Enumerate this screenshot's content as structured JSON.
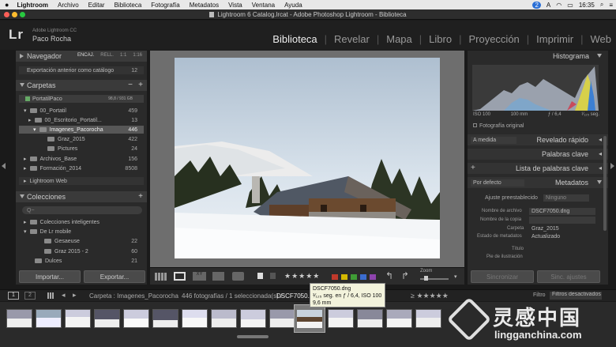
{
  "menubar": {
    "items": [
      "Lightroom",
      "Archivo",
      "Editar",
      "Biblioteca",
      "Fotografía",
      "Metadatos",
      "Vista",
      "Ventana",
      "Ayuda"
    ],
    "status": {
      "badge": "2",
      "flag": "A",
      "time": "16:35"
    }
  },
  "window": {
    "title": "Lightroom 6 Catalog.lrcat - Adobe Photoshop Lightroom - Biblioteca"
  },
  "brand": {
    "logo": "Lr",
    "product": "Adobe Lightroom CC",
    "user": "Paco Rocha"
  },
  "modules": [
    "Biblioteca",
    "Revelar",
    "Mapa",
    "Libro",
    "Proyección",
    "Imprimir",
    "Web"
  ],
  "left": {
    "navigator": {
      "title": "Navegador",
      "zoom": [
        "ENCAJ.",
        "RELL.",
        "1:1",
        "1:16"
      ]
    },
    "export_row": {
      "label": "Exportación anterior como catálogo",
      "count": "12"
    },
    "folders": {
      "title": "Carpetas",
      "volume": {
        "label": "PortatilPaco",
        "size": "98,8 / 931 GB"
      },
      "items": [
        {
          "label": "00_Portatil",
          "count": "459"
        },
        {
          "label": "00_Escritorio_Portatil...",
          "count": "13"
        },
        {
          "label": "Imagenes_Pacorocha",
          "count": "446"
        },
        {
          "label": "Graz_2015",
          "count": "422"
        },
        {
          "label": "Pictures",
          "count": "24"
        },
        {
          "label": "Archivos_Base",
          "count": "156"
        },
        {
          "label": "Formación_2014",
          "count": "8508"
        }
      ]
    },
    "web": {
      "label": "Lightroom Web"
    },
    "collections": {
      "title": "Colecciones",
      "search_placeholder": "Q~",
      "items": [
        {
          "label": "Colecciones inteligentes",
          "count": ""
        },
        {
          "label": "De Lr mobile",
          "count": ""
        },
        {
          "label": "Gesaeuse",
          "count": "22"
        },
        {
          "label": "Graz 2015 - 2",
          "count": "60"
        },
        {
          "label": "Dulces",
          "count": "21"
        }
      ]
    },
    "buttons": {
      "import": "Importar...",
      "export": "Exportar..."
    }
  },
  "right": {
    "histogram": {
      "title": "Histograma",
      "iso": "ISO 100",
      "focal": "100 mm",
      "aperture": "ƒ / 6,4",
      "shutter": "¹⁄₁₂₅ seg.",
      "original": "Fotografía original"
    },
    "quick_develop": {
      "title": "Revelado rápido",
      "preset": "A medida"
    },
    "keywords": {
      "title": "Palabras clave"
    },
    "keyword_list": {
      "title": "Lista de palabras clave"
    },
    "metadata": {
      "title": "Metadatos",
      "preset_select": "Por defecto",
      "preset_label": "Ajuste preestablecido",
      "preset_value": "Ninguno",
      "fields": [
        {
          "label": "Nombre de archivo",
          "value": "DSCF7050.dng"
        },
        {
          "label": "Nombre de la copia",
          "value": ""
        },
        {
          "label": "Carpeta",
          "value": "Graz_2015"
        },
        {
          "label": "Estado de metadatos",
          "value": "Actualizado"
        },
        {
          "label": "Título",
          "value": ""
        },
        {
          "label": "Pie de ilustración",
          "value": ""
        }
      ]
    },
    "buttons": {
      "sync": "Sincronizar",
      "sync_settings": "Sinc. ajustes"
    }
  },
  "toolbar": {
    "stars": "★★★★★",
    "zoom_label": "Zoom",
    "colors": [
      "#c0392b",
      "#d4b800",
      "#3f9c35",
      "#3b6ccf",
      "#8e44ad"
    ]
  },
  "filmstrip_bar": {
    "pages": [
      "1",
      "2"
    ],
    "path": "Carpeta : Imagenes_Pacorocha",
    "count": "446 fotografías / 1 seleccionada(s) /",
    "filename": "DSCF7050.dng",
    "filter_label": "Filtro",
    "filter_value": "Filtros desactivados"
  },
  "tooltip": {
    "line1": "DSCF7050.dng",
    "line2": "¹⁄₁₂₅ seg. en ƒ / 6,4, ISO 100",
    "line3": "9,6 mm"
  },
  "watermark": {
    "cn": "灵感中国",
    "url": "lingganchina.com"
  }
}
